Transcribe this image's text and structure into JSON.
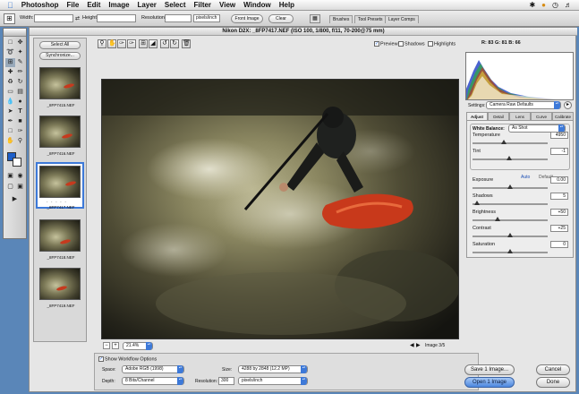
{
  "menubar": {
    "app_name": "Photoshop",
    "items": [
      "File",
      "Edit",
      "Image",
      "Layer",
      "Select",
      "Filter",
      "View",
      "Window",
      "Help"
    ]
  },
  "options_bar": {
    "width_label": "Width:",
    "height_label": "Height:",
    "resolution_label": "Resolution:",
    "resolution_unit": "pixels/inch",
    "front_image_button": "Front Image",
    "clear_button": "Clear",
    "palette_tabs": [
      "Brushes",
      "Tool Presets",
      "Layer Comps"
    ]
  },
  "dialog": {
    "title": "Nikon D2X: _8FP7417.NEF (ISO 100, 1/800, f/11, 70-200@75 mm)",
    "rgb_readout": "R: 83  G: 81  B: 66",
    "preview_label": "Preview",
    "shadows_label": "Shadows",
    "highlights_label": "Highlights",
    "preview_checked": true
  },
  "filmstrip": {
    "select_all_button": "Select All",
    "synchronize_button": "Synchronize...",
    "thumbnails": [
      {
        "label": "_8FP7415.NEF",
        "selected": false
      },
      {
        "label": "_8FP7416.NEF",
        "selected": false
      },
      {
        "label": "_8FP7417.NEF",
        "selected": true
      },
      {
        "label": "_8FP7418.NEF",
        "selected": false
      },
      {
        "label": "_8FP7419.NEF",
        "selected": false
      }
    ]
  },
  "zoom": {
    "value": "21.4%",
    "image_counter": "Image 3/5"
  },
  "settings": {
    "label": "Settings:",
    "value": "Camera Raw Defaults",
    "tabs": [
      "Adjust",
      "Detail",
      "Lens",
      "Curve",
      "Calibrate"
    ],
    "active_tab": "Adjust"
  },
  "adjust": {
    "white_balance_label": "White Balance:",
    "white_balance_value": "As Shot",
    "auto_label": "Auto",
    "default_label": "Default",
    "sliders": [
      {
        "label": "Temperature",
        "value": "4950",
        "position": 0.42
      },
      {
        "label": "Tint",
        "value": "-1",
        "position": 0.49
      },
      {
        "label": "Exposure",
        "value": "0.00",
        "position": 0.5
      },
      {
        "label": "Shadows",
        "value": "5",
        "position": 0.06
      },
      {
        "label": "Brightness",
        "value": "+50",
        "position": 0.33
      },
      {
        "label": "Contrast",
        "value": "+25",
        "position": 0.5
      },
      {
        "label": "Saturation",
        "value": "0",
        "position": 0.5
      }
    ]
  },
  "workflow": {
    "checkbox_label": "Show Workflow Options",
    "checked": true,
    "space_label": "Space:",
    "space_value": "Adobe RGB (1998)",
    "depth_label": "Depth:",
    "depth_value": "8 Bits/Channel",
    "size_label": "Size:",
    "size_value": "4288 by 2848 (12.2 MP)",
    "resolution_label": "Resolution:",
    "resolution_value": "300",
    "resolution_unit": "pixels/inch"
  },
  "buttons": {
    "save": "Save 1 Image...",
    "open": "Open 1 Image",
    "cancel": "Cancel",
    "done": "Done"
  },
  "colors": {
    "accent": "#3d79d8",
    "kayak_red": "#c8391b"
  }
}
